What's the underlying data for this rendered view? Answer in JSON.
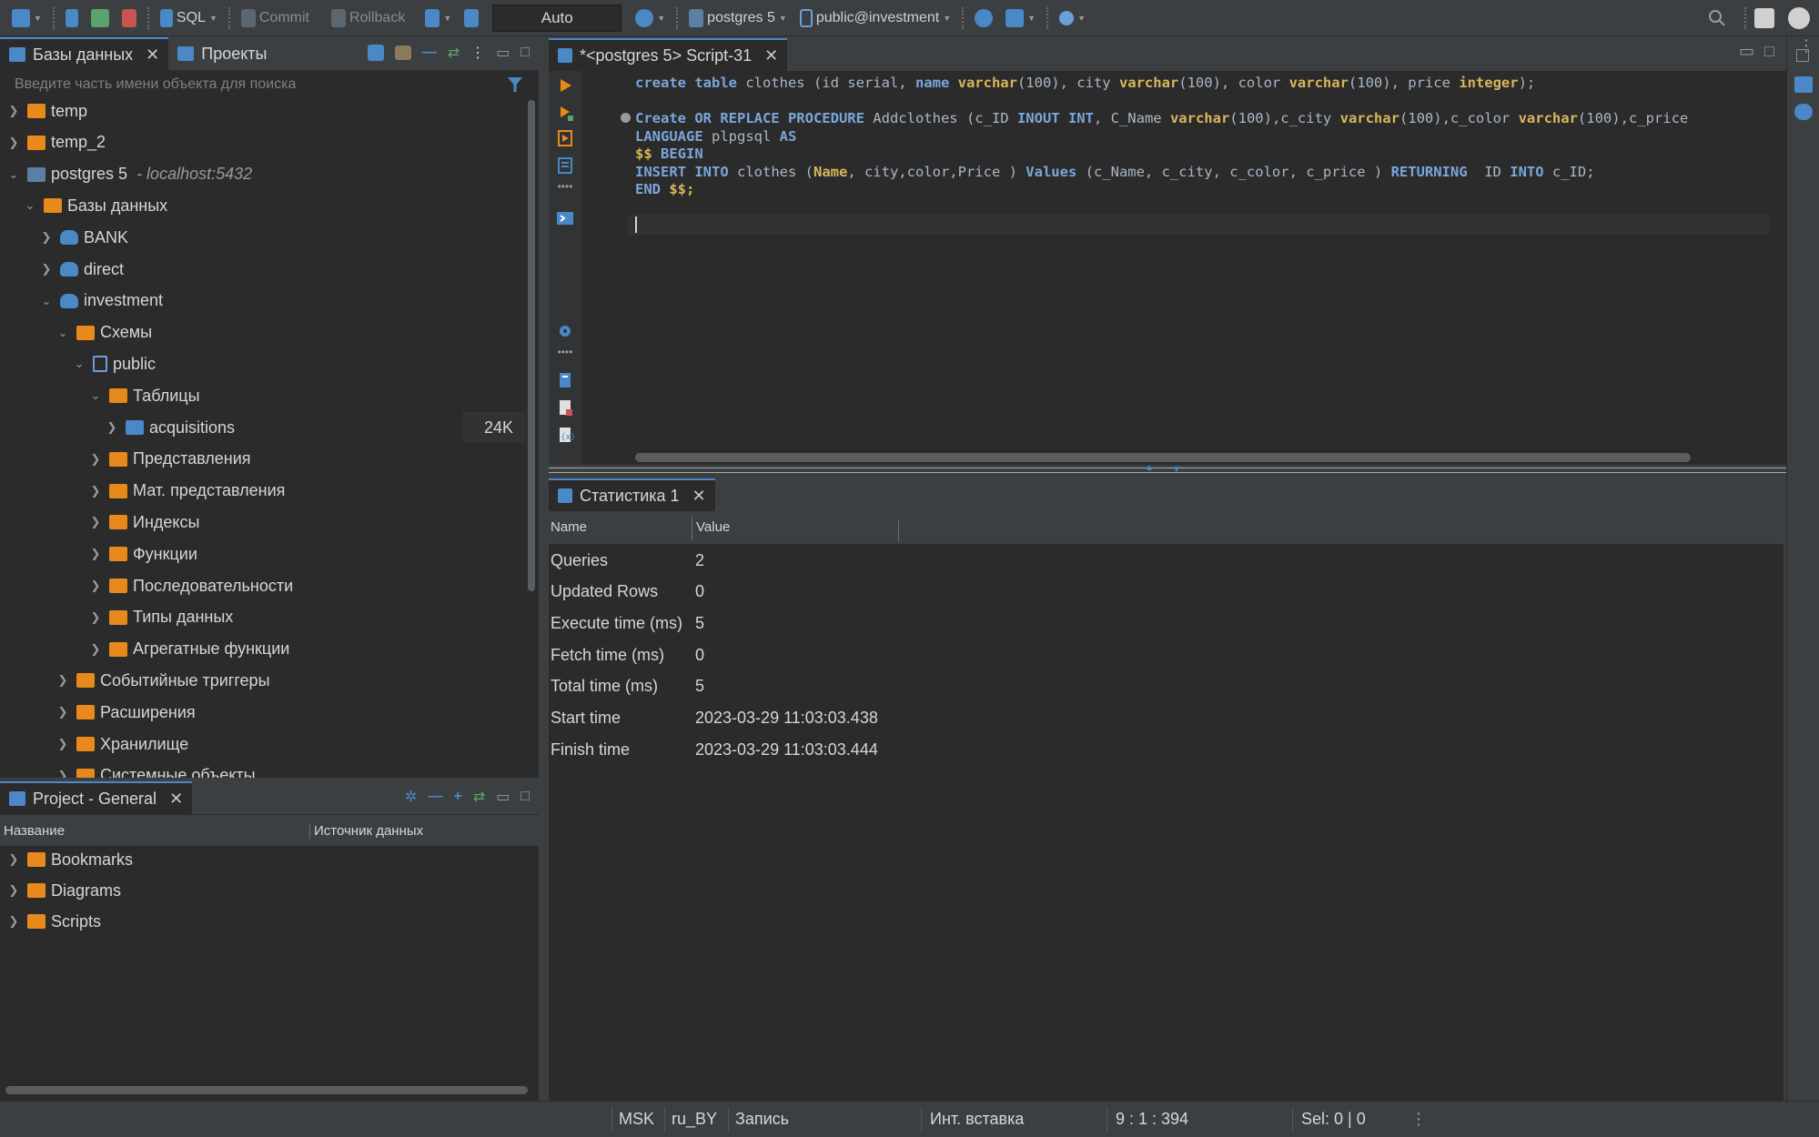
{
  "toolbar": {
    "sql_label": "SQL",
    "commit_label": "Commit",
    "rollback_label": "Rollback",
    "tx_mode": "Auto",
    "connection": "postgres 5",
    "schema": "public@investment"
  },
  "db_panel": {
    "tabs": [
      {
        "label": "Базы данных",
        "active": true
      },
      {
        "label": "Проекты",
        "active": false
      }
    ],
    "search_placeholder": "Введите часть имени объекта для поиска",
    "tree": [
      {
        "label": "temp",
        "icon": "folder-icon",
        "depth": 0,
        "expanded": false
      },
      {
        "label": "temp_2",
        "icon": "folder-icon",
        "depth": 0,
        "expanded": false
      },
      {
        "label": "postgres 5",
        "suffix": "- localhost:5432",
        "icon": "postgres-icon",
        "depth": 0,
        "expanded": true
      },
      {
        "label": "Базы данных",
        "icon": "folder-icon",
        "depth": 1,
        "expanded": true
      },
      {
        "label": "BANK",
        "icon": "database-icon",
        "depth": 2,
        "expanded": false
      },
      {
        "label": "direct",
        "icon": "database-icon",
        "depth": 2,
        "expanded": false
      },
      {
        "label": "investment",
        "icon": "database-icon",
        "depth": 2,
        "expanded": true
      },
      {
        "label": "Схемы",
        "icon": "folder-icon",
        "depth": 3,
        "expanded": true
      },
      {
        "label": "public",
        "icon": "schema-icon",
        "depth": 4,
        "expanded": true
      },
      {
        "label": "Таблицы",
        "icon": "folder-icon",
        "depth": 5,
        "expanded": true
      },
      {
        "label": "acquisitions",
        "icon": "table-icon",
        "depth": 6,
        "expanded": false,
        "badge": "24K"
      },
      {
        "label": "Представления",
        "icon": "folder-icon",
        "depth": 5,
        "expanded": false
      },
      {
        "label": "Мат. представления",
        "icon": "folder-icon",
        "depth": 5,
        "expanded": false
      },
      {
        "label": "Индексы",
        "icon": "folder-icon",
        "depth": 5,
        "expanded": false
      },
      {
        "label": "Функции",
        "icon": "folder-icon",
        "depth": 5,
        "expanded": false
      },
      {
        "label": "Последовательности",
        "icon": "folder-icon",
        "depth": 5,
        "expanded": false
      },
      {
        "label": "Типы данных",
        "icon": "folder-icon",
        "depth": 5,
        "expanded": false
      },
      {
        "label": "Агрегатные функции",
        "icon": "folder-icon",
        "depth": 5,
        "expanded": false
      },
      {
        "label": "Событийные триггеры",
        "icon": "folder-icon",
        "depth": 3,
        "expanded": false
      },
      {
        "label": "Расширения",
        "icon": "folder-icon",
        "depth": 3,
        "expanded": false
      },
      {
        "label": "Хранилище",
        "icon": "folder-icon",
        "depth": 3,
        "expanded": false
      },
      {
        "label": "Системные объекты",
        "icon": "folder-icon",
        "depth": 3,
        "expanded": false
      }
    ]
  },
  "project_panel": {
    "tab_label": "Project - General",
    "columns": [
      "Название",
      "Источник данных"
    ],
    "items": [
      {
        "label": "Bookmarks",
        "icon": "bookmarks-icon"
      },
      {
        "label": "Diagrams",
        "icon": "diagrams-icon"
      },
      {
        "label": "Scripts",
        "icon": "scripts-icon"
      }
    ]
  },
  "editor": {
    "tab_label": "*<postgres 5> Script-31"
  },
  "stats": {
    "tab_label": "Статистика 1",
    "columns": [
      "Name",
      "Value"
    ],
    "rows": [
      {
        "name": "Queries",
        "value": "2"
      },
      {
        "name": "Updated Rows",
        "value": "0"
      },
      {
        "name": "Execute time (ms)",
        "value": "5"
      },
      {
        "name": "Fetch time (ms)",
        "value": "0"
      },
      {
        "name": "Total time (ms)",
        "value": "5"
      },
      {
        "name": "Start time",
        "value": "2023-03-29 11:03:03.438"
      },
      {
        "name": "Finish time",
        "value": "2023-03-29 11:03:03.444"
      }
    ]
  },
  "statusbar": {
    "timezone": "MSK",
    "locale": "ru_BY",
    "mode": "Запись",
    "insert_mode": "Инт. вставка",
    "position": "9 : 1 : 394",
    "selection": "Sel: 0 | 0"
  },
  "colors": {
    "accent": "#4a88c7",
    "folder": "#e8891c",
    "keyword": "#7aa6da",
    "type": "#d8b65a"
  }
}
